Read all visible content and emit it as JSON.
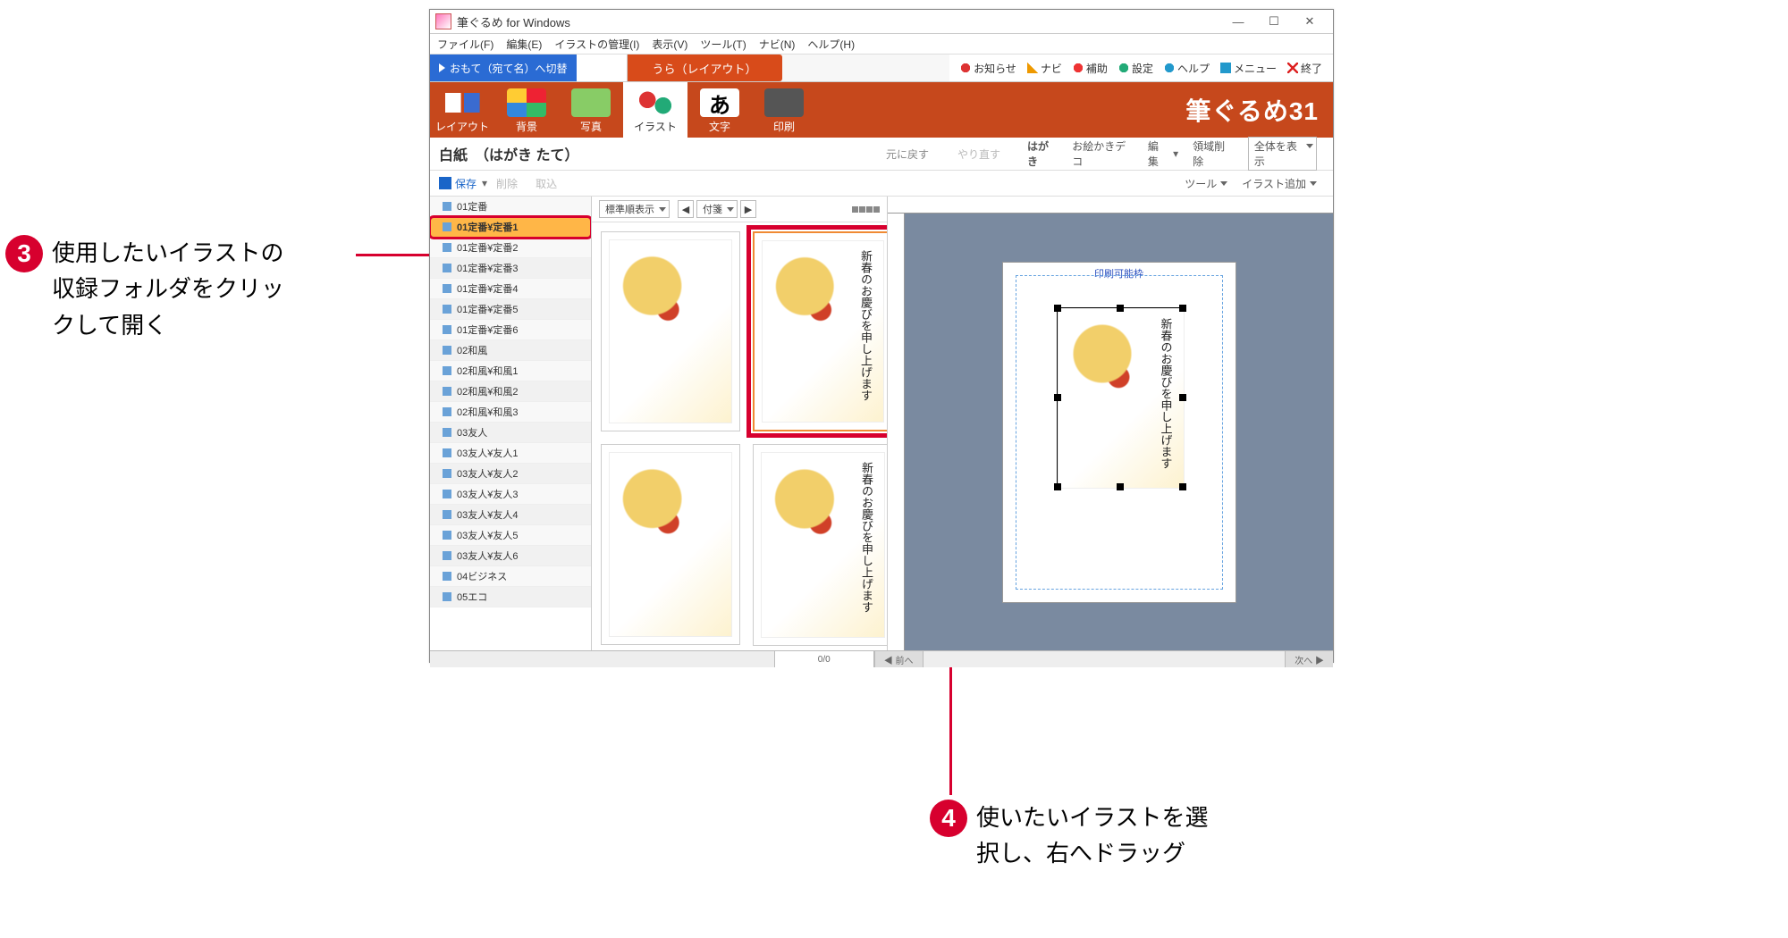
{
  "annotations": {
    "step3_num": "3",
    "step3_text": "使用したいイラストの\n収録フォルダをクリッ\nクして開く",
    "step4_num": "4",
    "step4_text": "使いたいイラストを選\n択し、右へドラッグ"
  },
  "window": {
    "title": "筆ぐるめ for Windows"
  },
  "menu": {
    "file": "ファイル(F)",
    "edit": "編集(E)",
    "illmgr": "イラストの管理(I)",
    "view": "表示(V)",
    "tool": "ツール(T)",
    "navi": "ナビ(N)",
    "help": "ヘルプ(H)"
  },
  "modetabs": {
    "omo_switch": "おもて（宛て名）へ切替",
    "ura": "うら（レイアウト）"
  },
  "right_actions": {
    "news": "お知らせ",
    "navi": "ナビ",
    "assist": "補助",
    "settings": "設定",
    "help": "ヘルプ",
    "menu": "メニュー",
    "exit": "終了"
  },
  "toolbar": {
    "layout": "レイアウト",
    "bg": "背景",
    "photo": "写真",
    "illust": "イラスト",
    "text": "文字",
    "print": "印刷"
  },
  "brand": "筆ぐるめ31",
  "subheader": {
    "left": "白紙　（はがき たて）",
    "undo": "元に戻す",
    "redo": "やり直す",
    "hagaki": "はがき",
    "deco": "お絵かきデコ",
    "edit": "編集",
    "del": "領域削除",
    "zoom": "全体を表示"
  },
  "smallbar": {
    "save": "保存",
    "delete": "削除",
    "import": "取込",
    "tool": "ツール",
    "add": "イラスト追加"
  },
  "folders": [
    "01定番",
    "01定番¥定番1",
    "01定番¥定番2",
    "01定番¥定番3",
    "01定番¥定番4",
    "01定番¥定番5",
    "01定番¥定番6",
    "02和風",
    "02和風¥和風1",
    "02和風¥和風2",
    "02和風¥和風3",
    "03友人",
    "03友人¥友人1",
    "03友人¥友人2",
    "03友人¥友人3",
    "03友人¥友人4",
    "03友人¥友人5",
    "03友人¥友人6",
    "04ビジネス",
    "05エコ"
  ],
  "selected_folder_index": 1,
  "thumbs_toolbar": {
    "sort": "標準順表示",
    "attach": "付箋"
  },
  "preview": {
    "printable_label": "印刷可能枠"
  },
  "pager": {
    "count": "0/0",
    "prev": "◀ 前へ",
    "next": "次へ ▶"
  },
  "thumb_text": "新春のお慶びを申し上げます"
}
